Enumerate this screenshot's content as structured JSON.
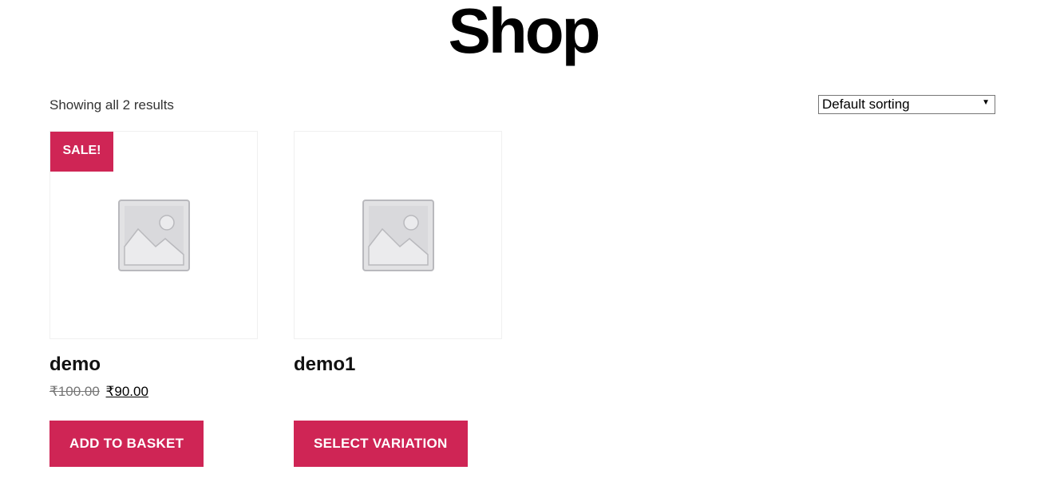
{
  "page": {
    "title": "Shop"
  },
  "toolbar": {
    "result_count": "Showing all 2 results",
    "ordering_selected": "Default sorting"
  },
  "colors": {
    "accent": "#cf2555",
    "text": "#28303d"
  },
  "products": [
    {
      "name": "demo",
      "badge": "SALE!",
      "regular_price": "₹100.00",
      "sale_price": "₹90.00",
      "button_label": "ADD TO BASKET",
      "image_icon": "image-placeholder-icon"
    },
    {
      "name": "demo1",
      "button_label": "SELECT VARIATION",
      "image_icon": "image-placeholder-icon"
    }
  ]
}
